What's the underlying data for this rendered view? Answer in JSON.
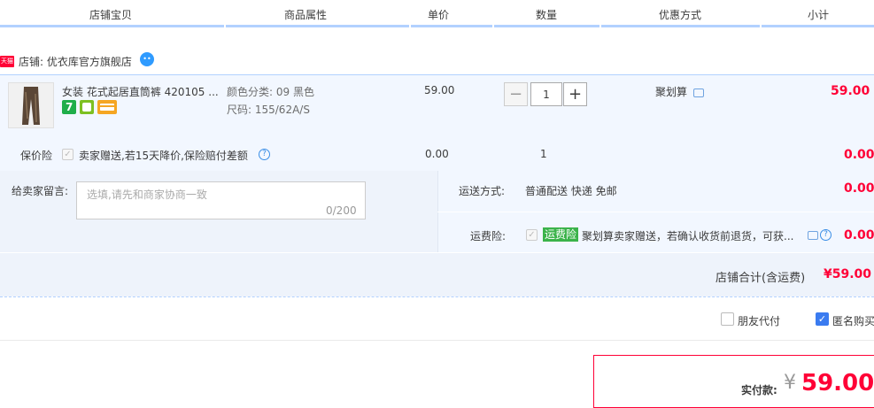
{
  "header": {
    "columns": [
      "店铺宝贝",
      "商品属性",
      "单价",
      "数量",
      "优惠方式",
      "小计"
    ]
  },
  "shop": {
    "badge": "天猫",
    "name": "店铺: 优衣库官方旗舰店"
  },
  "item": {
    "title": "女装 花式起居直筒裤 420105 ...",
    "color": "颜色分类: 09 黑色",
    "size": "尺码: 155/62A/S",
    "price": "59.00",
    "quantity": "1",
    "minus": "−",
    "plus": "+",
    "promotion": "聚划算",
    "subtotal": "59.00"
  },
  "insurance": {
    "label": "保价险",
    "text": "卖家赠送,若15天降价,保险赔付差额",
    "price": "0.00",
    "qty": "1",
    "subtotal": "0.00"
  },
  "message": {
    "label": "给卖家留言:",
    "placeholder": "选填,请先和商家协商一致",
    "counter": "0/200"
  },
  "shipping": {
    "label": "运送方式:",
    "value": "普通配送 快递 免邮",
    "fee": "0.00"
  },
  "freight_insurance": {
    "label": "运费险:",
    "tag": "运费险",
    "text": "聚划算卖家赠送，若确认收货前退货，可获...",
    "fee": "0.00"
  },
  "store_total": {
    "label": "店铺合计(含运费)",
    "value": "¥59.00"
  },
  "options": {
    "friend_pay": "朋友代付",
    "anonymous": "匿名购买"
  },
  "payment": {
    "label": "实付款:",
    "currency": "¥",
    "amount": "59.00"
  },
  "colors": {
    "accent_red": "#ff0036",
    "header_line": "#b2d1ff",
    "row_bg": "#f2f7ff",
    "tag_green": "#3bb34a"
  }
}
